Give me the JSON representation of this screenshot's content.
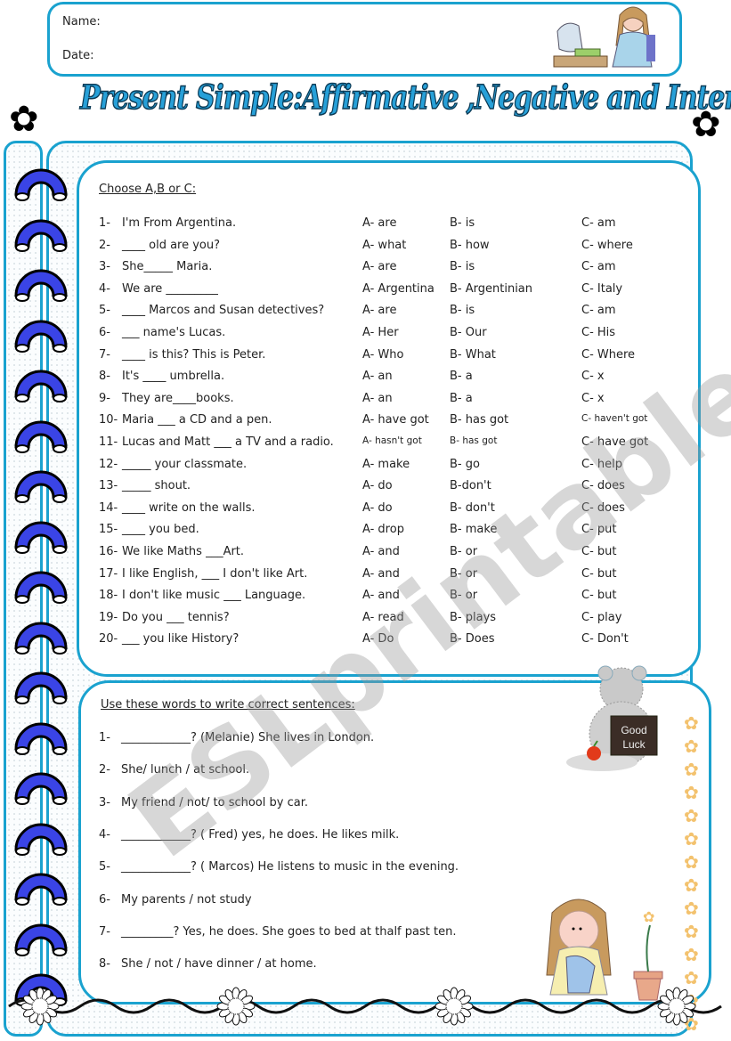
{
  "header": {
    "name_label": "Name:",
    "date_label": "Date:"
  },
  "title": "Present Simple:Affirmative ,Negative and Interrogative form",
  "colors": {
    "frame": "#1aa2cf",
    "title_fill": "#27a0d8",
    "title_outline": "#0b3a55",
    "ring": "#3a44e6",
    "watermark": "#999999"
  },
  "watermark": "ESLprintables.com",
  "exercise1": {
    "instruction": "Choose  A,B or C:",
    "questions": [
      {
        "num": "1-",
        "text": "I'm From Argentina.",
        "a": "A- are",
        "b": "B- is",
        "c": "C- am"
      },
      {
        "num": "2-",
        "text": "____ old are you?",
        "a": "A- what",
        "b": "B- how",
        "c": "C- where"
      },
      {
        "num": "3-",
        "text": "She_____ Maria.",
        "a": "A- are",
        "b": "B- is",
        "c": "C- am"
      },
      {
        "num": "4-",
        "text": "We are _________",
        "a": "A- Argentina",
        "b": "B- Argentinian",
        "c": "C- Italy"
      },
      {
        "num": "5-",
        "text": "____ Marcos and Susan detectives?",
        "a": "A- are",
        "b": "B- is",
        "c": "C- am"
      },
      {
        "num": "6-",
        "text": "___ name's Lucas.",
        "a": "A- Her",
        "b": "B- Our",
        "c": "C- His"
      },
      {
        "num": "7-",
        "text": "____ is this? This is Peter.",
        "a": "A- Who",
        "b": "B- What",
        "c": "C- Where"
      },
      {
        "num": "8-",
        "text": "It's ____ umbrella.",
        "a": "A- an",
        "b": "B- a",
        "c": "C- x"
      },
      {
        "num": "9-",
        "text": "They are____books.",
        "a": "A- an",
        "b": "B- a",
        "c": "C- x"
      },
      {
        "num": "10-",
        "text": "Maria ___ a CD and a pen.",
        "a": "A- have got",
        "b": "B- has got",
        "c": "C- haven't got"
      },
      {
        "num": "11-",
        "text": "Lucas and Matt ___ a TV and a radio.",
        "a": "A- hasn't got",
        "b": "B- has got",
        "c": "C- have got"
      },
      {
        "num": "12-",
        "text": "_____ your classmate.",
        "a": "A- make",
        "b": "B- go",
        "c": "C- help"
      },
      {
        "num": "13-",
        "text": "_____ shout.",
        "a": "A- do",
        "b": "B-don't",
        "c": "C- does"
      },
      {
        "num": "14-",
        "text": "____ write on the walls.",
        "a": "A- do",
        "b": "B- don't",
        "c": "C- does"
      },
      {
        "num": "15-",
        "text": "____ you bed.",
        "a": "A- drop",
        "b": "B- make",
        "c": "C- put"
      },
      {
        "num": "16-",
        "text": "We like Maths ___Art.",
        "a": "A- and",
        "b": "B- or",
        "c": "C- but"
      },
      {
        "num": "17-",
        "text": "I like English, ___ I don't like Art.",
        "a": "A- and",
        "b": "B- or",
        "c": "C- but"
      },
      {
        "num": "18-",
        "text": "I don't like music ___ Language.",
        "a": "A- and",
        "b": "B- or",
        "c": "C- but"
      },
      {
        "num": "19-",
        "text": "Do you ___ tennis?",
        "a": "A- read",
        "b": "B- plays",
        "c": "C- play"
      },
      {
        "num": "20-",
        "text": "     ___ you like History?",
        "a": "A- Do",
        "b": "B- Does",
        "c": "C- Don't"
      }
    ]
  },
  "exercise2": {
    "instruction": "Use these words to write correct sentences:",
    "items": [
      {
        "num": "1-",
        "text": "____________? (Melanie) She lives in London."
      },
      {
        "num": "2-",
        "text": "She/ lunch / at school."
      },
      {
        "num": "3-",
        "text": "My friend / not/ to school by car."
      },
      {
        "num": "4-",
        "text": "____________? ( Fred) yes, he does. He likes milk."
      },
      {
        "num": "5-",
        "text": "____________? ( Marcos) He listens to music in the evening."
      },
      {
        "num": "6-",
        "text": "My parents / not study"
      },
      {
        "num": "7-",
        "text": "_________? Yes, he does. She goes to bed at thalf past ten."
      },
      {
        "num": "8-",
        "text": "She / not / have dinner / at home."
      }
    ]
  },
  "sign_text": {
    "line1": "Good",
    "line2": "Luck"
  }
}
